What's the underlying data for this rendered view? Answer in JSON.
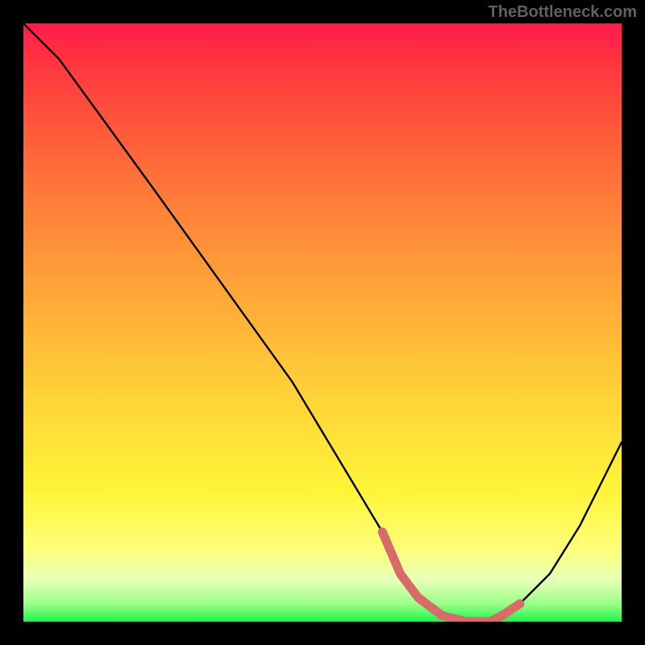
{
  "watermark": "TheBottleneck.com",
  "chart_data": {
    "type": "line",
    "title": "",
    "xlabel": "",
    "ylabel": "",
    "xlim": [
      0,
      100
    ],
    "ylim": [
      0,
      100
    ],
    "series": [
      {
        "name": "curve",
        "x": [
          0,
          6,
          22,
          45,
          60,
          63,
          66,
          70,
          74,
          78,
          80,
          83,
          88,
          93,
          100
        ],
        "y": [
          100,
          94,
          72,
          40,
          15,
          8,
          4,
          1,
          0,
          0,
          1,
          3,
          8,
          16,
          30
        ]
      }
    ],
    "highlight_segment": {
      "x": [
        60,
        63,
        66,
        70,
        74,
        78,
        80,
        83
      ],
      "y": [
        15,
        8,
        4,
        1,
        0,
        0,
        1,
        3
      ]
    },
    "background_gradient": [
      "#ff1a4d",
      "#ff3340",
      "#ff5a3a",
      "#ff8439",
      "#ffa938",
      "#ffd238",
      "#fff438",
      "#fdff7a",
      "#e7ffb8",
      "#9cff8a",
      "#1cf54a"
    ],
    "frame_color": "#000000"
  }
}
